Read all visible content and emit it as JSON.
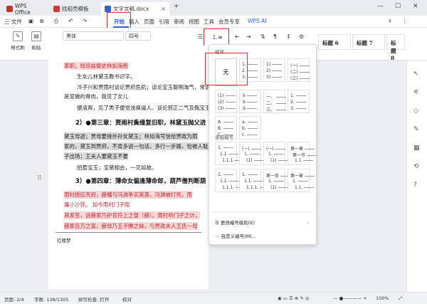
{
  "titlebar": {
    "tabs": [
      {
        "label": "WPS Office",
        "icon": "wps-logo-icon",
        "color": "#c9302c"
      },
      {
        "label": "找稻壳模板",
        "icon": "docer-icon",
        "color": "#d8343a"
      },
      {
        "label": "文字文稿.docx",
        "icon": "writer-doc-icon",
        "color": "#2b64d7"
      }
    ],
    "new_tab": "+"
  },
  "menubar": {
    "file": "三 文件",
    "items": [
      "开始",
      "插入",
      "页面",
      "引用",
      "审阅",
      "视图",
      "工具",
      "会员专享"
    ],
    "active": "开始",
    "wps_ai": "WPS AI"
  },
  "ribbon": {
    "format_painter": "格式刷",
    "paste": "粘贴",
    "font_name": "黑体",
    "font_size": "四号",
    "styles": [
      "标题 6",
      "标题 7",
      "标题 8"
    ],
    "accent": "#2b64d7"
  },
  "document": {
    "lines": [
      {
        "text": "革职，给巡盐御史林如海抱",
        "style": "red hl-pink"
      },
      {
        "text": "生女儿林黛玉教书识字。",
        "style": ""
      },
      {
        "text": "冷子兴和贾雨村谈论贾府危机；谈论宝玉聪明淘气，常说",
        "style": ""
      },
      {
        "text": "是泥做的骨肉，我见了女儿",
        "style": ""
      },
      {
        "text": "便清爽，见了男子便觉浊臭逼人。谈论邪正二气及甄宝玉",
        "style": ""
      },
      {
        "text": "2）●第三章：贾雨村夤缘复旧职，林黛玉抛父进",
        "style": "head"
      },
      {
        "text": "黛玉母逝；贾母要接外孙女黛玉；林如海写信给贾政为雨",
        "style": "hl-gray"
      },
      {
        "text": "家的，黛玉到贾府，不肯多说一句话，多行一步路，恰被人耻笑",
        "style": "hl-gray"
      },
      {
        "text": "子出场；王夫人要黛玉不要",
        "style": "hl-gray"
      },
      {
        "text": "招惹宝玉；宝黛相会，一见如故。",
        "style": "hl-gray"
      },
      {
        "text": "3）●第四章：薄命女偏逢薄命郎，葫芦僧判断葫",
        "style": "head"
      },
      {
        "text": "雨村授应天府，薛蟠与冯渊争买英莲，冯渊被打死。雨",
        "style": "red hl-pink"
      },
      {
        "text": "庸小沙弥。 如今雨村门子阻",
        "style": "red"
      },
      {
        "text": "其发签，说薛家乃护官符上之雪（薛）。雨村听门子之计，",
        "style": "red hl-pink"
      },
      {
        "text": "薛家百万之富，薛母乃王子腾之妹，与贾政夫人王氏一母",
        "style": "red hl-pink"
      }
    ],
    "footer": "红楼梦"
  },
  "numbering_panel": {
    "section1": "编号",
    "none": "无",
    "styles_row1": [
      [
        "1.",
        "2.",
        "3."
      ],
      [
        "1)",
        "2)",
        "3)"
      ],
      [
        "(一)",
        "(二)",
        "(三)"
      ]
    ],
    "styles_row2": [
      [
        "(1)",
        "(2)",
        "(3)"
      ],
      [
        "①",
        "②",
        "③"
      ],
      [
        "一、",
        "二、",
        "三、"
      ],
      [
        "1.",
        "2.",
        "3."
      ]
    ],
    "styles_row3": [
      [
        "A.",
        "B.",
        "C."
      ],
      [
        "a.",
        "b.",
        "c."
      ]
    ],
    "section2": "多级编号",
    "multi_row1": [
      [
        "1.",
        "1.1",
        "1.1.1"
      ],
      [
        "(一)",
        "1.",
        "(1)"
      ],
      [
        "(一)",
        "1.",
        "(1)"
      ],
      [
        "第一章",
        "第一节",
        "1.1"
      ]
    ],
    "multi_row2": [
      [
        "1.",
        "1.1.",
        "1.1.1."
      ],
      [
        "1.",
        "1.1.",
        "1.1.1."
      ],
      [
        "第一条",
        "1.",
        "(1)"
      ],
      [
        "第一章",
        "1.",
        "1.1."
      ]
    ],
    "change_level": "更改编号级别(E)",
    "custom": "自定义编号(M)..."
  },
  "statusbar": {
    "page": "页面: 2/4",
    "words": "字数: 138/1305",
    "spell": "拼写检查: 打开",
    "proof": "校对",
    "zoom": "100%"
  }
}
